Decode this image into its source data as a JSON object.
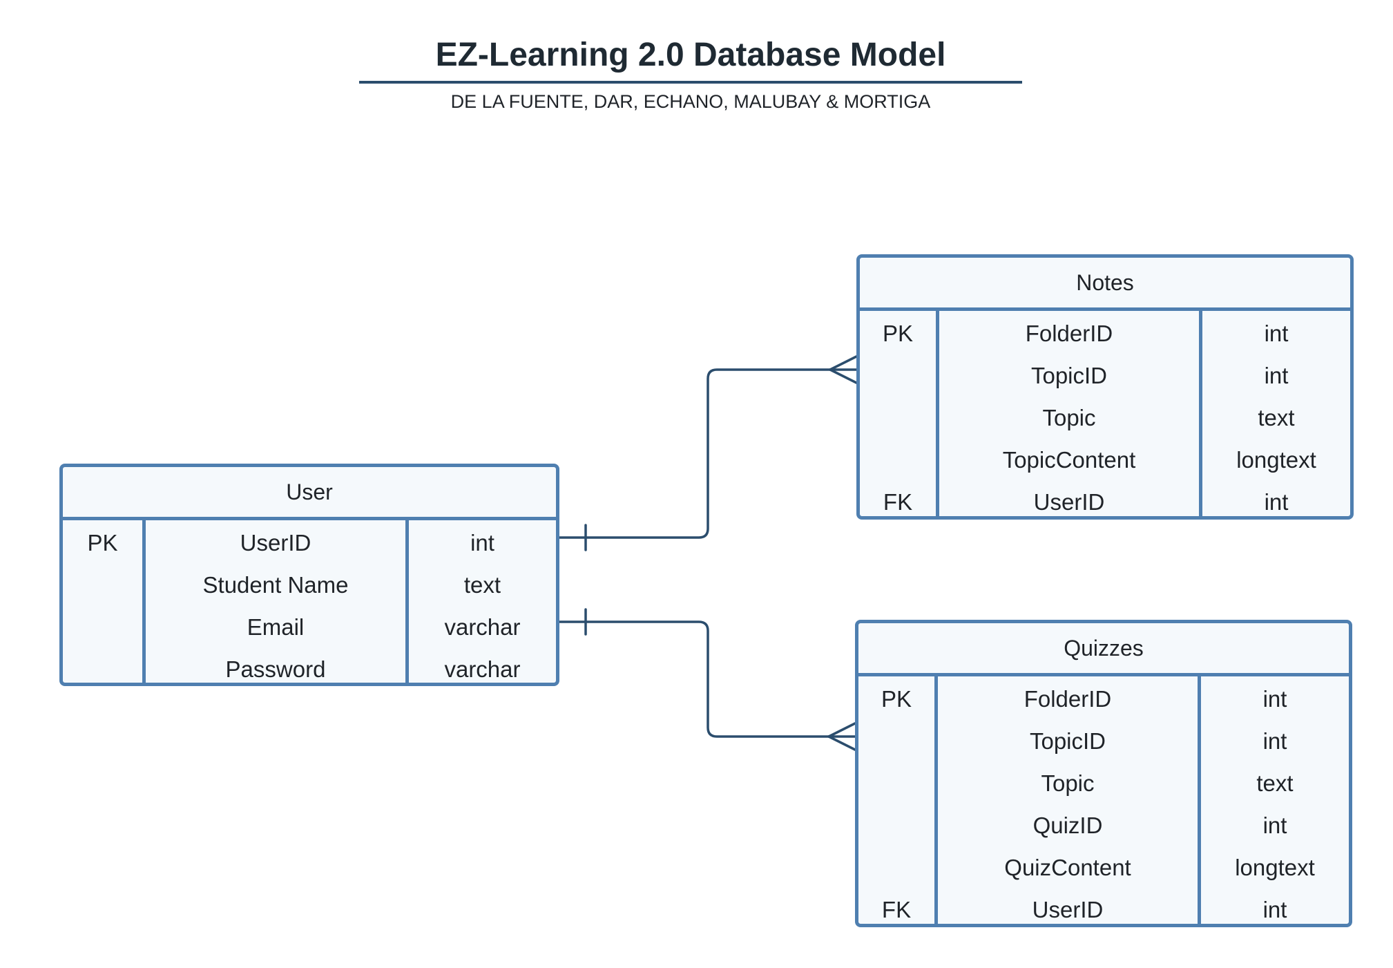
{
  "header": {
    "title": "EZ-Learning 2.0 Database Model",
    "subtitle": "DE LA FUENTE, DAR, ECHANO, MALUBAY & MORTIGA"
  },
  "entities": {
    "user": {
      "name": "User",
      "rows": [
        {
          "key": "PK",
          "field": "UserID",
          "type": "int"
        },
        {
          "key": "",
          "field": "Student Name",
          "type": "text"
        },
        {
          "key": "",
          "field": "Email",
          "type": "varchar"
        },
        {
          "key": "",
          "field": "Password",
          "type": "varchar"
        }
      ]
    },
    "notes": {
      "name": "Notes",
      "rows": [
        {
          "key": "PK",
          "field": "FolderID",
          "type": "int"
        },
        {
          "key": "",
          "field": "TopicID",
          "type": "int"
        },
        {
          "key": "",
          "field": "Topic",
          "type": "text"
        },
        {
          "key": "",
          "field": "TopicContent",
          "type": "longtext"
        },
        {
          "key": "FK",
          "field": "UserID",
          "type": "int"
        }
      ]
    },
    "quizzes": {
      "name": "Quizzes",
      "rows": [
        {
          "key": "PK",
          "field": "FolderID",
          "type": "int"
        },
        {
          "key": "",
          "field": "TopicID",
          "type": "int"
        },
        {
          "key": "",
          "field": "Topic",
          "type": "text"
        },
        {
          "key": "",
          "field": "QuizID",
          "type": "int"
        },
        {
          "key": "",
          "field": "QuizContent",
          "type": "longtext"
        },
        {
          "key": "FK",
          "field": "UserID",
          "type": "int"
        }
      ]
    }
  },
  "relationships": [
    {
      "from": "User",
      "to": "Notes",
      "from_cardinality": "one",
      "to_cardinality": "many"
    },
    {
      "from": "User",
      "to": "Quizzes",
      "from_cardinality": "one",
      "to_cardinality": "many"
    }
  ],
  "colors": {
    "entity_border": "#4f7fb0",
    "entity_fill": "#f5f9fc",
    "connector": "#2b4d6d",
    "title_rule": "#2b4d6d"
  }
}
